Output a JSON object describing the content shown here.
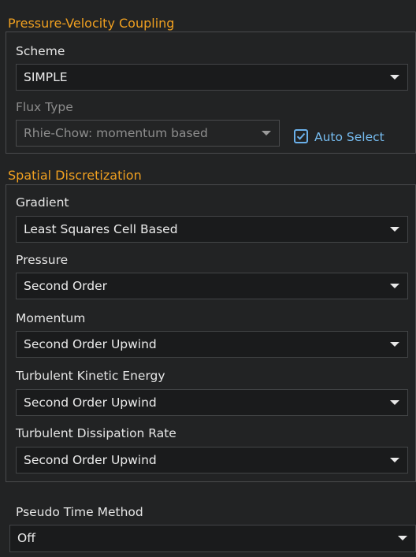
{
  "pressure_velocity": {
    "title": "Pressure-Velocity Coupling",
    "scheme_label": "Scheme",
    "scheme_value": "SIMPLE",
    "flux_type_label": "Flux Type",
    "flux_type_value": "Rhie-Chow: momentum based",
    "auto_select_label": "Auto Select",
    "auto_select_checked": true
  },
  "spatial": {
    "title": "Spatial Discretization",
    "items": [
      {
        "label": "Gradient",
        "value": "Least Squares Cell Based"
      },
      {
        "label": "Pressure",
        "value": "Second Order"
      },
      {
        "label": "Momentum",
        "value": "Second Order Upwind"
      },
      {
        "label": "Turbulent Kinetic Energy",
        "value": "Second Order Upwind"
      },
      {
        "label": "Turbulent Dissipation Rate",
        "value": "Second Order Upwind"
      }
    ]
  },
  "pseudo_time": {
    "label": "Pseudo Time Method",
    "value": "Off"
  },
  "colors": {
    "background": "#222324",
    "group_title": "#f0a020",
    "checkbox_accent": "#6ab0ea"
  },
  "icons": {
    "dropdown": "chevron-down-icon",
    "check": "check-icon"
  }
}
